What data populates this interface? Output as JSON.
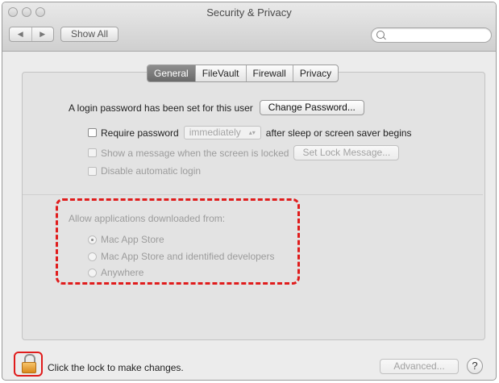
{
  "window": {
    "title": "Security & Privacy",
    "back_icon": "◀",
    "forward_icon": "▶",
    "show_all_label": "Show All",
    "search_placeholder": ""
  },
  "tabs": [
    {
      "label": "General",
      "selected": true
    },
    {
      "label": "FileVault",
      "selected": false
    },
    {
      "label": "Firewall",
      "selected": false
    },
    {
      "label": "Privacy",
      "selected": false
    }
  ],
  "general": {
    "login_password_text": "A login password has been set for this user",
    "change_password_label": "Change Password...",
    "require_password_label": "Require password",
    "require_password_checked": false,
    "require_password_timing": "immediately",
    "after_sleep_text": "after sleep or screen saver begins",
    "show_message_label": "Show a message when the screen is locked",
    "set_lock_message_label": "Set Lock Message...",
    "disable_auto_login_label": "Disable automatic login"
  },
  "downloads": {
    "heading": "Allow applications downloaded from:",
    "options": [
      {
        "label": "Mac App Store",
        "selected": true
      },
      {
        "label": "Mac App Store and identified developers",
        "selected": false
      },
      {
        "label": "Anywhere",
        "selected": false
      }
    ]
  },
  "footer": {
    "lock_text": "Click the lock to make changes.",
    "advanced_label": "Advanced...",
    "help_label": "?"
  },
  "colors": {
    "highlight": "#e01c1c",
    "lock": "#d9891b",
    "selected_tab": "#7a7a7a"
  }
}
